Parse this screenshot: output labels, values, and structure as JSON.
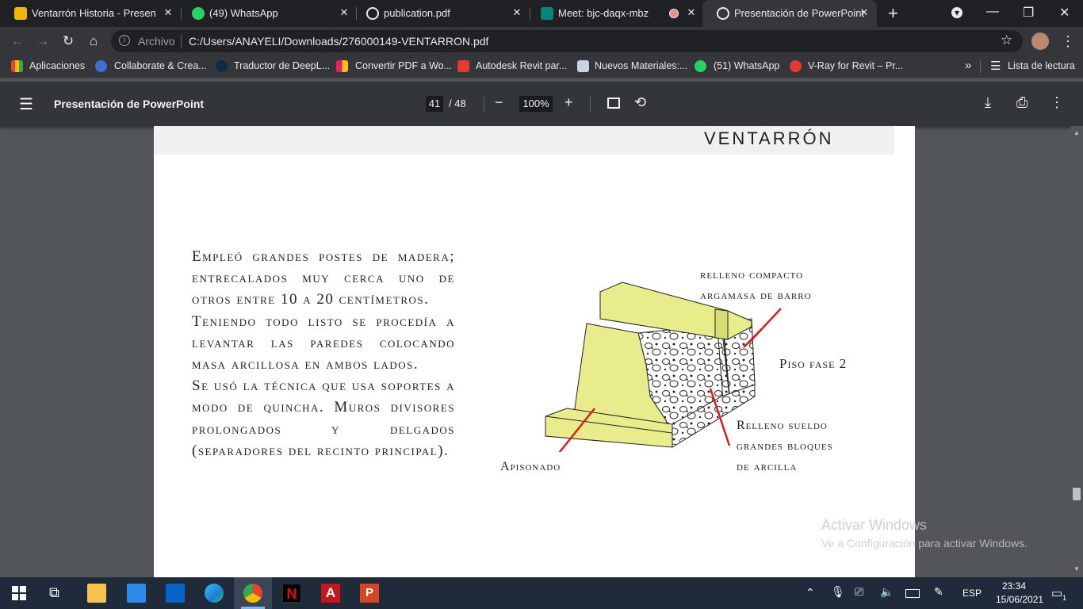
{
  "browser": {
    "tabs": [
      {
        "title": "Ventarrón Historia - Presentación",
        "color": "#f4b400"
      },
      {
        "title": "(49) WhatsApp",
        "color": "#25d366"
      },
      {
        "title": "publication.pdf",
        "color": "#e8eaed"
      },
      {
        "title": "Meet: bjc-daqx-mbz",
        "color": "#00897b"
      },
      {
        "title": "Presentación de PowerPoint",
        "color": "#e8eaed"
      }
    ],
    "new_tab_label": "+",
    "address": {
      "scheme_label": "Archivo",
      "url": "C:/Users/ANAYELI/Downloads/276000149-VENTARRON.pdf"
    },
    "bookmarks": [
      {
        "label": "Aplicaciones"
      },
      {
        "label": "Collaborate & Crea..."
      },
      {
        "label": "Traductor de DeepL..."
      },
      {
        "label": "Convertir PDF a Wo..."
      },
      {
        "label": "Autodesk Revit par..."
      },
      {
        "label": "Nuevos Materiales:..."
      },
      {
        "label": "(51) WhatsApp"
      },
      {
        "label": "V-Ray for Revit – Pr..."
      }
    ],
    "more_bookmarks": "»",
    "reading_list": "Lista de lectura"
  },
  "pdf_viewer": {
    "title": "Presentación de PowerPoint",
    "current_page": "41",
    "total_pages": "/ 48",
    "zoom": "100%"
  },
  "slide": {
    "header": "ventarrón",
    "paragraphs": [
      "Empleó grandes postes de madera; entrecalados muy cerca uno de otros entre 10 a 20 centímetros.",
      "Teniendo todo listo se procedía a levantar las paredes colocando masa arcillosa en ambos lados.",
      "Se usó la técnica que usa soportes a modo de quincha. Muros divisores prolongados y delgados (separadores del recinto principal)."
    ],
    "labels": {
      "top_line1": "relleno compacto",
      "top_line2": "argamasa de barro",
      "right": "Piso fase 2",
      "bottom_line1": "Relleno sueldo",
      "bottom_line2": "grandes bloques",
      "bottom_line3": "de arcilla",
      "left": "Apisonado"
    }
  },
  "watermark": {
    "line1": "Activar Windows",
    "line2": "Ve a Configuración para activar Windows."
  },
  "taskbar": {
    "language": "ESP",
    "time": "23:34",
    "date": "15/06/2021",
    "notifications": "1"
  },
  "colors": {
    "accent_yellow": "#e8ec8a",
    "red_line": "#d42020"
  }
}
